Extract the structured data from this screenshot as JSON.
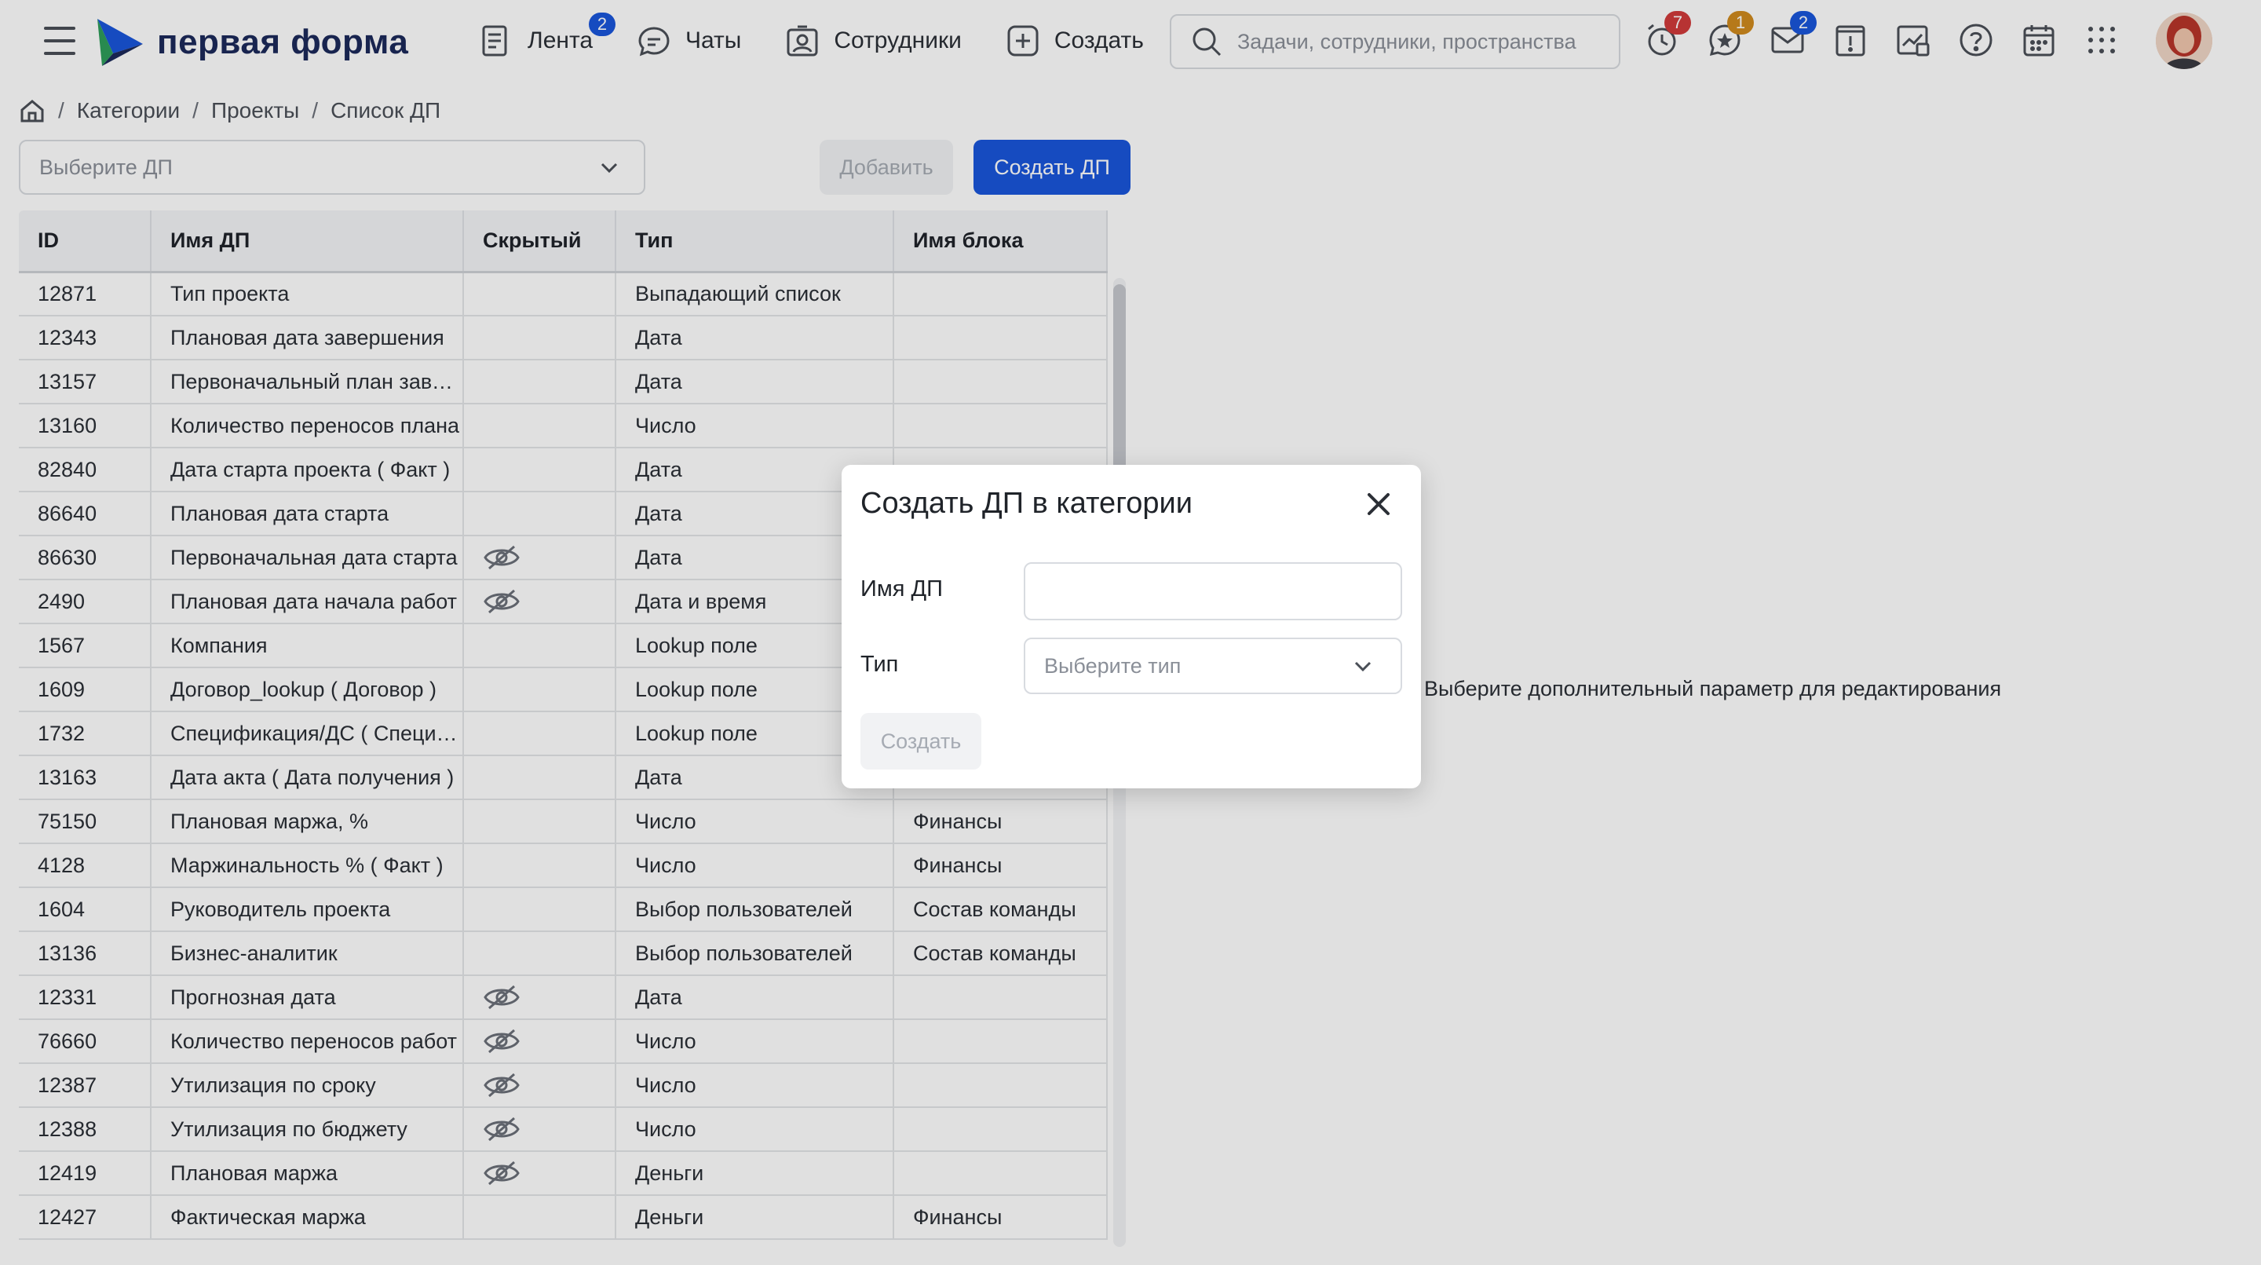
{
  "header": {
    "logo_text": "первая форма",
    "nav": [
      {
        "label": "Лента",
        "icon": "feed-icon",
        "badge": "2"
      },
      {
        "label": "Чаты",
        "icon": "chat-icon"
      },
      {
        "label": "Сотрудники",
        "icon": "employees-icon"
      },
      {
        "label": "Создать",
        "icon": "plus-square-icon"
      }
    ],
    "search_placeholder": "Задачи, сотрудники, пространства",
    "tool_badges": {
      "reminders": "7",
      "favorites": "1",
      "mail": "2"
    }
  },
  "breadcrumb": [
    "Категории",
    "Проекты",
    "Список ДП"
  ],
  "toolbar": {
    "select_placeholder": "Выберите ДП",
    "add_label": "Добавить",
    "create_label": "Создать ДП"
  },
  "table": {
    "columns": [
      "ID",
      "Имя ДП",
      "Скрытый",
      "Тип",
      "Имя блока"
    ],
    "rows": [
      {
        "id": "12871",
        "name": "Тип проекта",
        "hidden": false,
        "type": "Выпадающий список",
        "block": ""
      },
      {
        "id": "12343",
        "name": "Плановая дата завершения",
        "hidden": false,
        "type": "Дата",
        "block": ""
      },
      {
        "id": "13157",
        "name": "Первоначальный план завершения",
        "hidden": false,
        "type": "Дата",
        "block": ""
      },
      {
        "id": "13160",
        "name": "Количество переносов плана",
        "hidden": false,
        "type": "Число",
        "block": ""
      },
      {
        "id": "82840",
        "name": "Дата старта проекта ( Факт )",
        "hidden": false,
        "type": "Дата",
        "block": ""
      },
      {
        "id": "86640",
        "name": "Плановая дата старта",
        "hidden": false,
        "type": "Дата",
        "block": ""
      },
      {
        "id": "86630",
        "name": "Первоначальная дата старта",
        "hidden": true,
        "type": "Дата",
        "block": ""
      },
      {
        "id": "2490",
        "name": "Плановая дата начала работ",
        "hidden": true,
        "type": "Дата и время",
        "block": ""
      },
      {
        "id": "1567",
        "name": "Компания",
        "hidden": false,
        "type": "Lookup поле",
        "block": ""
      },
      {
        "id": "1609",
        "name": "Договор_lookup ( Договор )",
        "hidden": false,
        "type": "Lookup поле",
        "block": ""
      },
      {
        "id": "1732",
        "name": "Спецификация/ДС ( Спецификация )",
        "hidden": false,
        "type": "Lookup поле",
        "block": ""
      },
      {
        "id": "13163",
        "name": "Дата акта ( Дата получения )",
        "hidden": false,
        "type": "Дата",
        "block": ""
      },
      {
        "id": "75150",
        "name": "Плановая маржа, %",
        "hidden": false,
        "type": "Число",
        "block": "Финансы"
      },
      {
        "id": "4128",
        "name": "Маржинальность % ( Факт )",
        "hidden": false,
        "type": "Число",
        "block": "Финансы"
      },
      {
        "id": "1604",
        "name": "Руководитель проекта",
        "hidden": false,
        "type": "Выбор пользователей",
        "block": "Состав команды"
      },
      {
        "id": "13136",
        "name": "Бизнес-аналитик",
        "hidden": false,
        "type": "Выбор пользователей",
        "block": "Состав команды"
      },
      {
        "id": "12331",
        "name": "Прогнозная дата",
        "hidden": true,
        "type": "Дата",
        "block": ""
      },
      {
        "id": "76660",
        "name": "Количество переносов работ",
        "hidden": true,
        "type": "Число",
        "block": ""
      },
      {
        "id": "12387",
        "name": "Утилизация по сроку",
        "hidden": true,
        "type": "Число",
        "block": ""
      },
      {
        "id": "12388",
        "name": "Утилизация по бюджету",
        "hidden": true,
        "type": "Число",
        "block": ""
      },
      {
        "id": "12419",
        "name": "Плановая маржа",
        "hidden": true,
        "type": "Деньги",
        "block": ""
      },
      {
        "id": "12427",
        "name": "Фактическая маржа",
        "hidden": false,
        "type": "Деньги",
        "block": "Финансы"
      }
    ]
  },
  "right_panel": {
    "hint": "Выберите дополнительный параметр для редактирования"
  },
  "modal": {
    "title": "Создать ДП в категории",
    "name_label": "Имя ДП",
    "name_value": "",
    "type_label": "Тип",
    "type_placeholder": "Выберите тип",
    "create_label": "Создать"
  },
  "colors": {
    "accent": "#1a56db",
    "badge_red": "#d13b3b",
    "badge_orange": "#d08a1e"
  }
}
